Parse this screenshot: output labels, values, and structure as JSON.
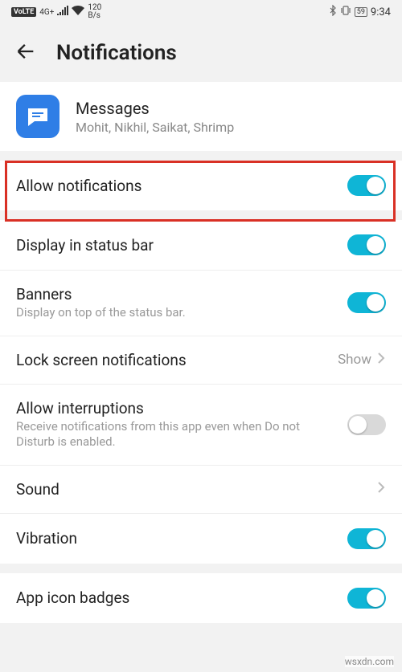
{
  "status": {
    "volte": "VoLTE",
    "signal_label": "4G+",
    "speed_top": "120",
    "speed_bottom": "B/s",
    "battery": "59",
    "time": "9:34"
  },
  "header": {
    "title": "Notifications"
  },
  "app": {
    "name": "Messages",
    "subtitle": "Mohit, Nikhil, Saikat, Shrimp"
  },
  "rows": {
    "allow": {
      "title": "Allow notifications"
    },
    "display_status": {
      "title": "Display in status bar"
    },
    "banners": {
      "title": "Banners",
      "sub": "Display on top of the status bar."
    },
    "lockscreen": {
      "title": "Lock screen notifications",
      "value": "Show"
    },
    "interruptions": {
      "title": "Allow interruptions",
      "sub": "Receive notifications from this app even when Do not Disturb is enabled."
    },
    "sound": {
      "title": "Sound"
    },
    "vibration": {
      "title": "Vibration"
    },
    "badges": {
      "title": "App icon badges"
    }
  },
  "watermark": "wsxdn.com"
}
